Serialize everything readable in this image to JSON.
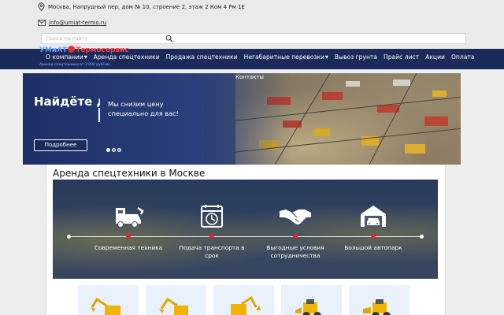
{
  "contact": {
    "address": "Москва, Напрудный пер, дом № 10, строение 2, этаж 2 Ком 4 Рм 1Е",
    "email": "info@umiat-termo.ru"
  },
  "search": {
    "placeholder": "Поиск по сайту"
  },
  "logo": {
    "part1": "УМиАТ",
    "part2": "Термосервис",
    "tagline": "Аренда спецтехники от 3 000 руб/час"
  },
  "nav": {
    "items": [
      {
        "label": "О компании",
        "caret": "▼"
      },
      {
        "label": "Аренда спецтехники"
      },
      {
        "label": "Продажа спецтехники"
      },
      {
        "label": "Негабаритные перевозки",
        "caret": "▼"
      },
      {
        "label": "Вывоз грунта"
      },
      {
        "label": "Прайс лист"
      },
      {
        "label": "Акции"
      },
      {
        "label": "Оплата"
      }
    ],
    "extra": "Контакты"
  },
  "banner": {
    "title": "Найдёте дешевле",
    "subtitle": "Мы снизим цену специально для вас!",
    "button": "Подробнее",
    "slides": 3,
    "active_slide": 1
  },
  "main": {
    "title": "Аренда спецтехники в Москве",
    "features": [
      {
        "icon": "truck-icon",
        "text": "Современная техника"
      },
      {
        "icon": "calendar-clock-icon",
        "text": "Подача транспорта в срок"
      },
      {
        "icon": "handshake-icon",
        "text": "Выгодные условия сотрудничества"
      },
      {
        "icon": "garage-icon",
        "text": "Большой автопарк"
      }
    ]
  },
  "thumbs": [
    "excavator-icon",
    "excavator-icon",
    "excavator-icon",
    "loader-icon",
    "loader-icon"
  ],
  "colors": {
    "nav": "#1b2a5b",
    "accent_red": "#e22222",
    "logo_blue": "#5fa0ff"
  }
}
